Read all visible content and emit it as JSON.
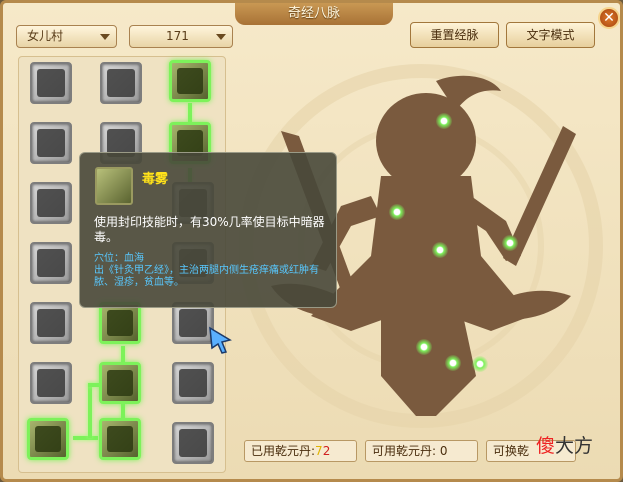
{
  "window": {
    "title": "奇经八脉"
  },
  "dropdowns": {
    "faction": "女儿村",
    "level": "171"
  },
  "buttons": {
    "reset": "重置经脉",
    "text_mode": "文字模式"
  },
  "tooltip": {
    "name": "毒雾",
    "description": "使用封印技能时，有30%几率使目标中暗器毒。",
    "acupoint": "穴位：血海",
    "source": "出《针灸甲乙经》，主治两腿内侧生疮痒痛或红肿有脓、湿疹，贫血等。"
  },
  "stats": {
    "used_label": "已用乾元丹:",
    "used_value": "7",
    "used_total": "2",
    "available_label": "可用乾元丹:",
    "available_value": "0",
    "exchangeable_label": "可换乾"
  },
  "watermark": {
    "red": "傻",
    "black": "大方"
  },
  "icons": {
    "close": "close-icon",
    "dropdown_arrow": "chevron-down-icon"
  },
  "colors": {
    "active_glow": "#7df25a",
    "tooltip_title": "#ffe21a",
    "tooltip_acupoint": "#58c8ff",
    "figure": "#7a5a3e"
  }
}
